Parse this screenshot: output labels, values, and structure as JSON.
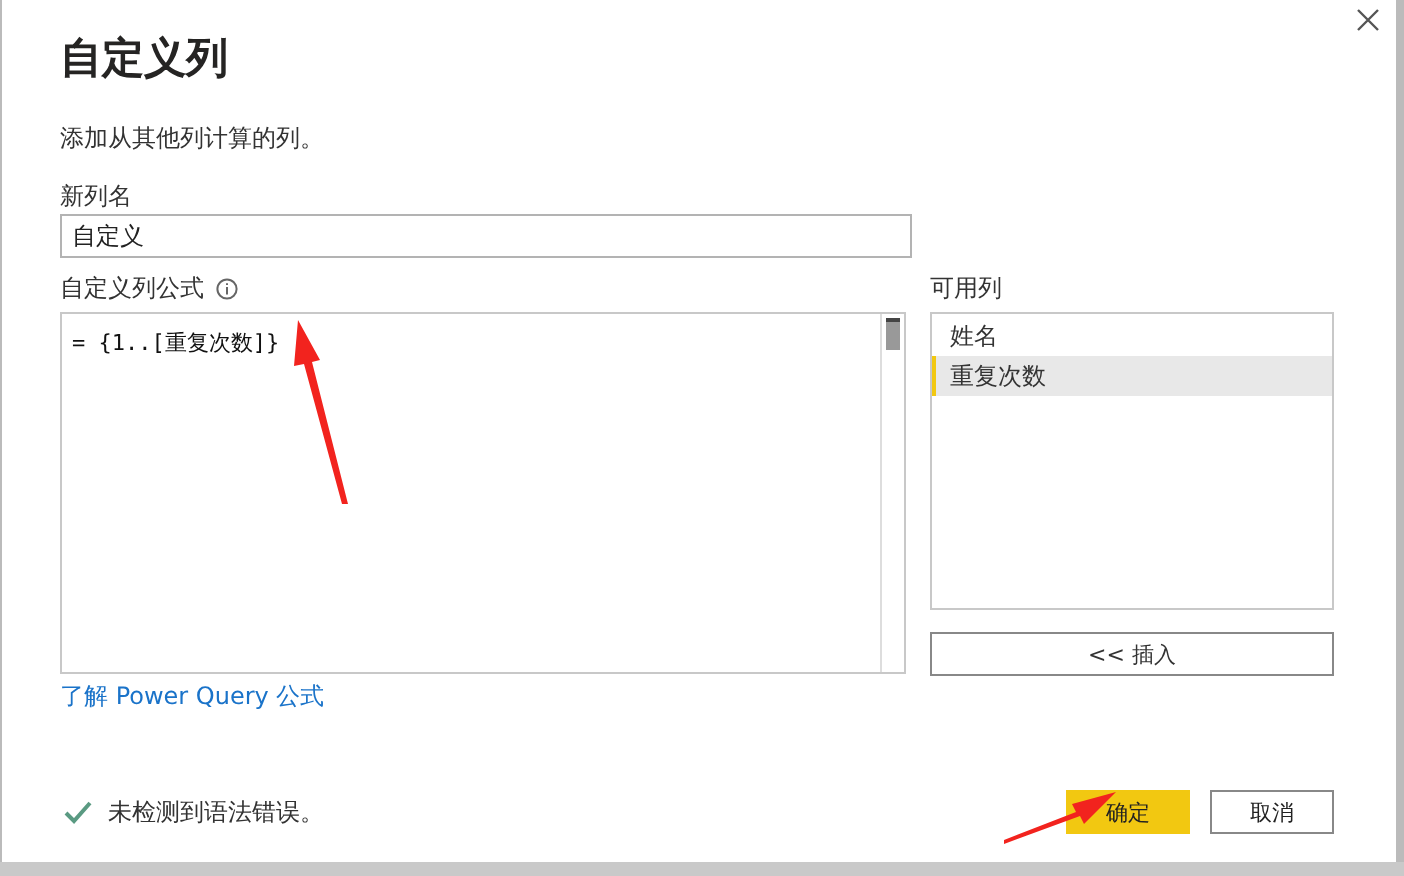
{
  "window": {
    "title": "自定义列",
    "subtitle": "添加从其他列计算的列。"
  },
  "new_column": {
    "label": "新列名",
    "value": "自定义"
  },
  "formula": {
    "label": "自定义列公式",
    "value": "= {1..[重复次数]}"
  },
  "available_columns": {
    "label": "可用列",
    "items": [
      {
        "name": "姓名",
        "selected": false
      },
      {
        "name": "重复次数",
        "selected": true
      }
    ],
    "insert_button": "<< 插入"
  },
  "link": "了解 Power Query 公式",
  "status": {
    "ok": true,
    "message": "未检测到语法错误。"
  },
  "buttons": [
    {
      "label": "确定",
      "primary": true
    },
    {
      "label": "取消",
      "primary": false
    }
  ]
}
